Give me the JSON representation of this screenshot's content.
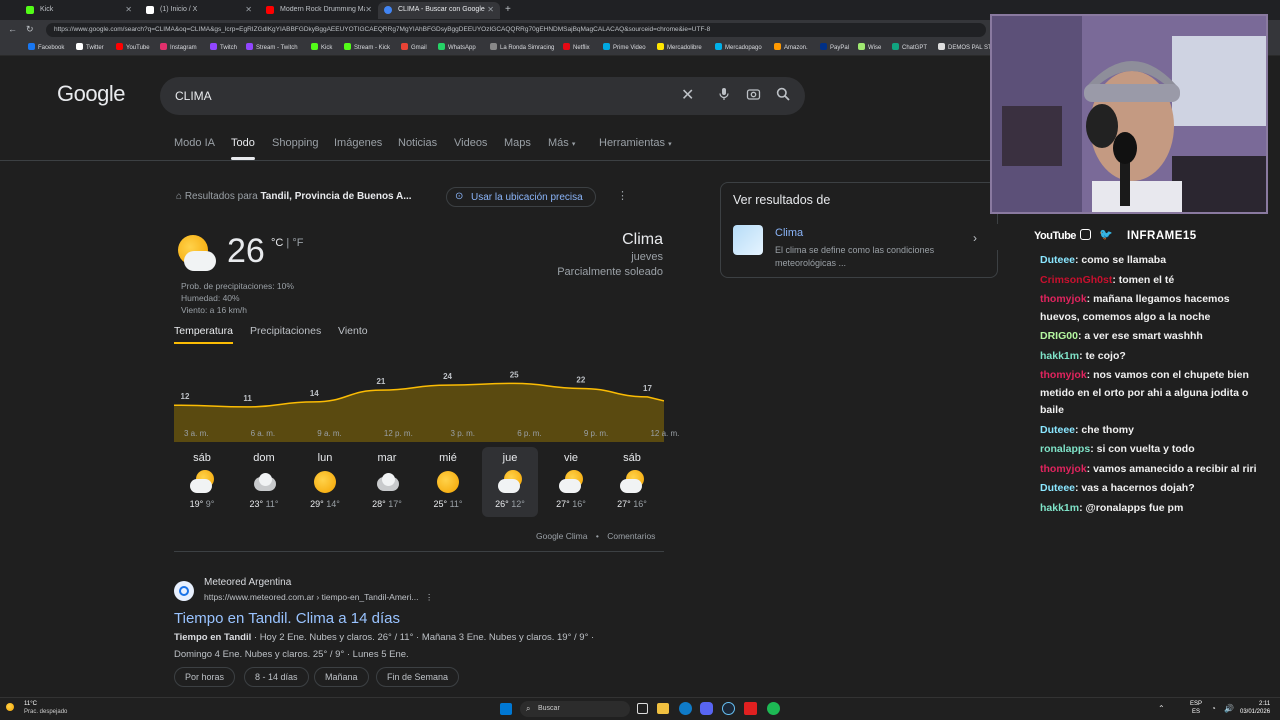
{
  "browser": {
    "tabs": [
      {
        "title": "Kick",
        "color": "#53fc18"
      },
      {
        "title": "(1) Inicio / X",
        "color": "#ffffff"
      },
      {
        "title": "Modern Rock Drumming Mastery",
        "color": "#ff0000"
      },
      {
        "title": "CLIMA - Buscar con Google",
        "color": "#4285f4"
      }
    ],
    "url": "https://www.google.com/search?q=CLIMA&oq=CLIMA&gs_lcrp=EgRIZGdlKgYIABBFGDkyBggAEEUYOTIGCAEQRRg7MgYIAhBFGDsyBggDEEUYOzIGCAQQRRg70gEHNDMSajBqMagCALACAQ&sourceid=chrome&ie=UTF-8",
    "bookmarks": [
      "Facebook",
      "Twitter",
      "YouTube",
      "Instagram",
      "Twitch",
      "Stream - Twitch",
      "Kick",
      "Stream - Kick",
      "Gmail",
      "WhatsApp",
      "La Ronda Simracing",
      "Netflix",
      "Prime Video",
      "Mercadolibre",
      "Mercadopago",
      "Amazon.",
      "PayPal",
      "Wise",
      "ChatGPT",
      "DEMOS PAL ST"
    ]
  },
  "google": {
    "logo": "Google",
    "query": "CLIMA",
    "tabs": [
      "Modo IA",
      "Todo",
      "Shopping",
      "Imágenes",
      "Noticias",
      "Videos",
      "Maps",
      "Más",
      "Herramientas"
    ],
    "location_prefix": "Resultados para",
    "location": "Tandil, Provincia de Buenos A...",
    "use_location": "Usar la ubicación precisa",
    "weather": {
      "temp": "26",
      "unit_c": "°C",
      "unit_sep": " | ",
      "unit_f": "°F",
      "precip": "Prob. de precipitaciones: 10%",
      "humidity": "Humedad: 40%",
      "wind": "Viento: a 16 km/h",
      "title": "Clima",
      "day": "jueves",
      "condition": "Parcialmente soleado",
      "tabs": [
        "Temperatura",
        "Precipitaciones",
        "Viento"
      ],
      "footer_source": "Google Clima",
      "footer_sep": "•",
      "footer_comments": "Comentarios"
    },
    "right_panel": {
      "title": "Ver resultados de",
      "item_title": "Clima",
      "item_desc": "El clima se define como las condiciones meteorológicas ..."
    },
    "result": {
      "site": "Meteored Argentina",
      "url": "https://www.meteored.com.ar › tiempo-en_Tandil-Ameri...",
      "title": "Tiempo en Tandil. Clima a 14 días",
      "snippet_bold": "Tiempo en Tandil",
      "snippet": " · Hoy 2 Ene. Nubes y claros. 26° / 11° · Mañana 3 Ene. Nubes y claros. 19° / 9° ·",
      "snippet2": "Domingo 4 Ene. Nubes y claros. 25° / 9° · Lunes 5 Ene.",
      "chips": [
        "Por horas",
        "8 - 14 días",
        "Mañana",
        "Fin de Semana"
      ]
    }
  },
  "chart_data": {
    "type": "area",
    "x": [
      "3 a. m.",
      "6 a. m.",
      "9 a. m.",
      "12 p. m.",
      "3 p. m.",
      "6 p. m.",
      "9 p. m.",
      "12 a. m."
    ],
    "series": [
      {
        "values": [
          12,
          11,
          14,
          21,
          24,
          25,
          22,
          17
        ]
      }
    ],
    "color": "#fbbc04"
  },
  "forecast": [
    {
      "day": "sáb",
      "hi": "19°",
      "lo": "9°",
      "icon": "partly-cloudy"
    },
    {
      "day": "dom",
      "hi": "23°",
      "lo": "11°",
      "icon": "cloudy"
    },
    {
      "day": "lun",
      "hi": "29°",
      "lo": "14°",
      "icon": "sunny"
    },
    {
      "day": "mar",
      "hi": "28°",
      "lo": "17°",
      "icon": "cloudy"
    },
    {
      "day": "mié",
      "hi": "25°",
      "lo": "11°",
      "icon": "sunny"
    },
    {
      "day": "jue",
      "hi": "26°",
      "lo": "12°",
      "icon": "partly-cloudy",
      "active": true
    },
    {
      "day": "vie",
      "hi": "27°",
      "lo": "16°",
      "icon": "partly-cloudy"
    },
    {
      "day": "sáb",
      "hi": "27°",
      "lo": "16°",
      "icon": "partly-cloudy"
    }
  ],
  "stream": {
    "social_youtube": "YouTube",
    "handle": "INFRAME15",
    "chat": [
      {
        "user": "Duteee",
        "color": "#8ae6ff",
        "text": ": como se llamaba"
      },
      {
        "user": "CrimsonGh0st",
        "color": "#c8102e",
        "text": ": tomen el té"
      },
      {
        "user": "thomyjok",
        "color": "#e0245e",
        "text": ": mañana llegamos hacemos huevos, comemos algo a la noche"
      },
      {
        "user": "DRIG00",
        "color": "#b4f7a0",
        "text": ": a ver ese smart washhh"
      },
      {
        "user": "hakk1m",
        "color": "#7fe3c8",
        "text": ": te cojo?"
      },
      {
        "user": "thomyjok",
        "color": "#e0245e",
        "text": ": nos vamos con el chupete bien metido en el orto por ahi a alguna jodita o baile"
      },
      {
        "user": "Duteee",
        "color": "#8ae6ff",
        "text": ": che thomy"
      },
      {
        "user": "ronalapps",
        "color": "#7fe3c8",
        "text": ": si con vuelta y todo"
      },
      {
        "user": "thomyjok",
        "color": "#e0245e",
        "text": ": vamos amanecido a recibir al riri"
      },
      {
        "user": "Duteee",
        "color": "#8ae6ff",
        "text": ": vas a hacernos dojah?"
      },
      {
        "user": "hakk1m",
        "color": "#7fe3c8",
        "text": ": @ronalapps fue pm"
      }
    ]
  },
  "taskbar": {
    "weather_temp": "11°C",
    "weather_desc": "Prac. despejado",
    "search": "Buscar",
    "lang1": "ESP",
    "lang2": "ES",
    "time": "2:11",
    "date": "03/01/2026"
  }
}
